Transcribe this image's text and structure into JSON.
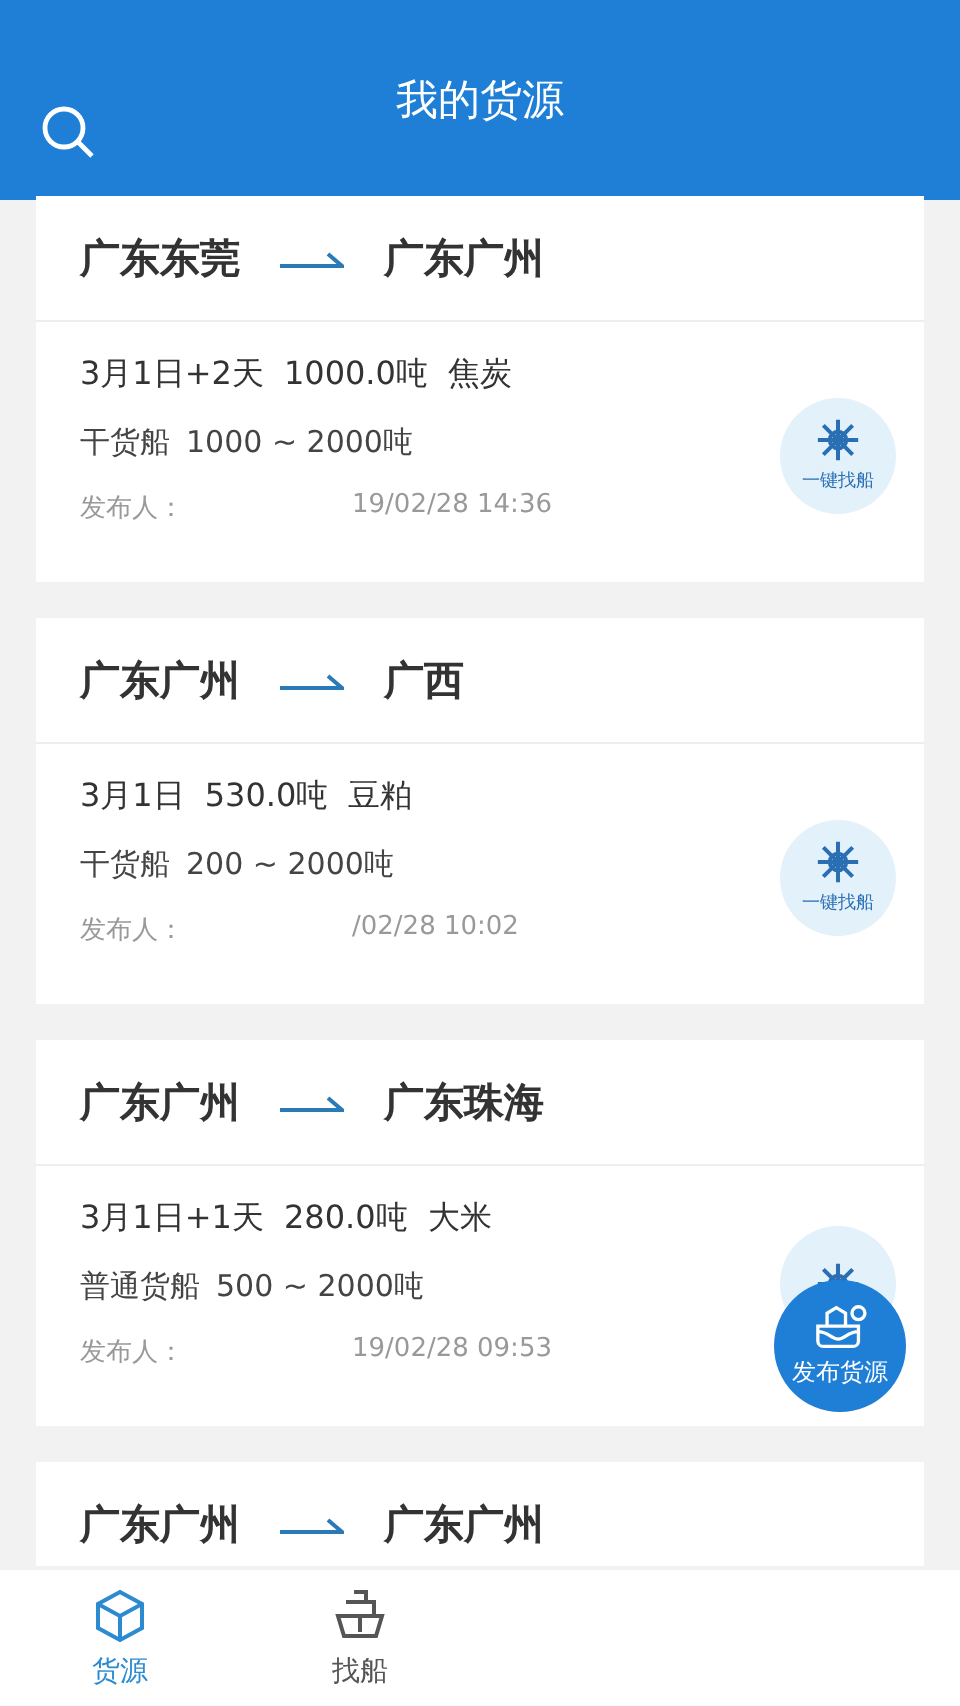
{
  "header": {
    "title": "我的货源"
  },
  "cargo_list": [
    {
      "from": "广东东莞",
      "to": "广东广州",
      "schedule": "3月1日+2天",
      "weight": "1000.0吨",
      "goods": "焦炭",
      "ship_type": "干货船",
      "tonnage": "1000 ~ 2000吨",
      "publisher_label": "发布人：",
      "published_at": "19/02/28 14:36",
      "find_ship": "一键找船"
    },
    {
      "from": "广东广州",
      "to": "广西",
      "schedule": "3月1日",
      "weight": "530.0吨",
      "goods": "豆粕",
      "ship_type": "干货船",
      "tonnage": "200 ~ 2000吨",
      "publisher_label": "发布人：",
      "published_at": "/02/28 10:02",
      "find_ship": "一键找船"
    },
    {
      "from": "广东广州",
      "to": "广东珠海",
      "schedule": "3月1日+1天",
      "weight": "280.0吨",
      "goods": "大米",
      "ship_type": "普通货船",
      "tonnage": "500 ~ 2000吨",
      "publisher_label": "发布人：",
      "published_at": "19/02/28 09:53"
    },
    {
      "from": "广东广州",
      "to": "广东广州"
    }
  ],
  "publish_button": {
    "label": "发布货源"
  },
  "tab_bar": [
    {
      "label": "货源",
      "kind": "cargo",
      "selected": true
    },
    {
      "label": "找船",
      "kind": "ship",
      "selected": false
    }
  ]
}
